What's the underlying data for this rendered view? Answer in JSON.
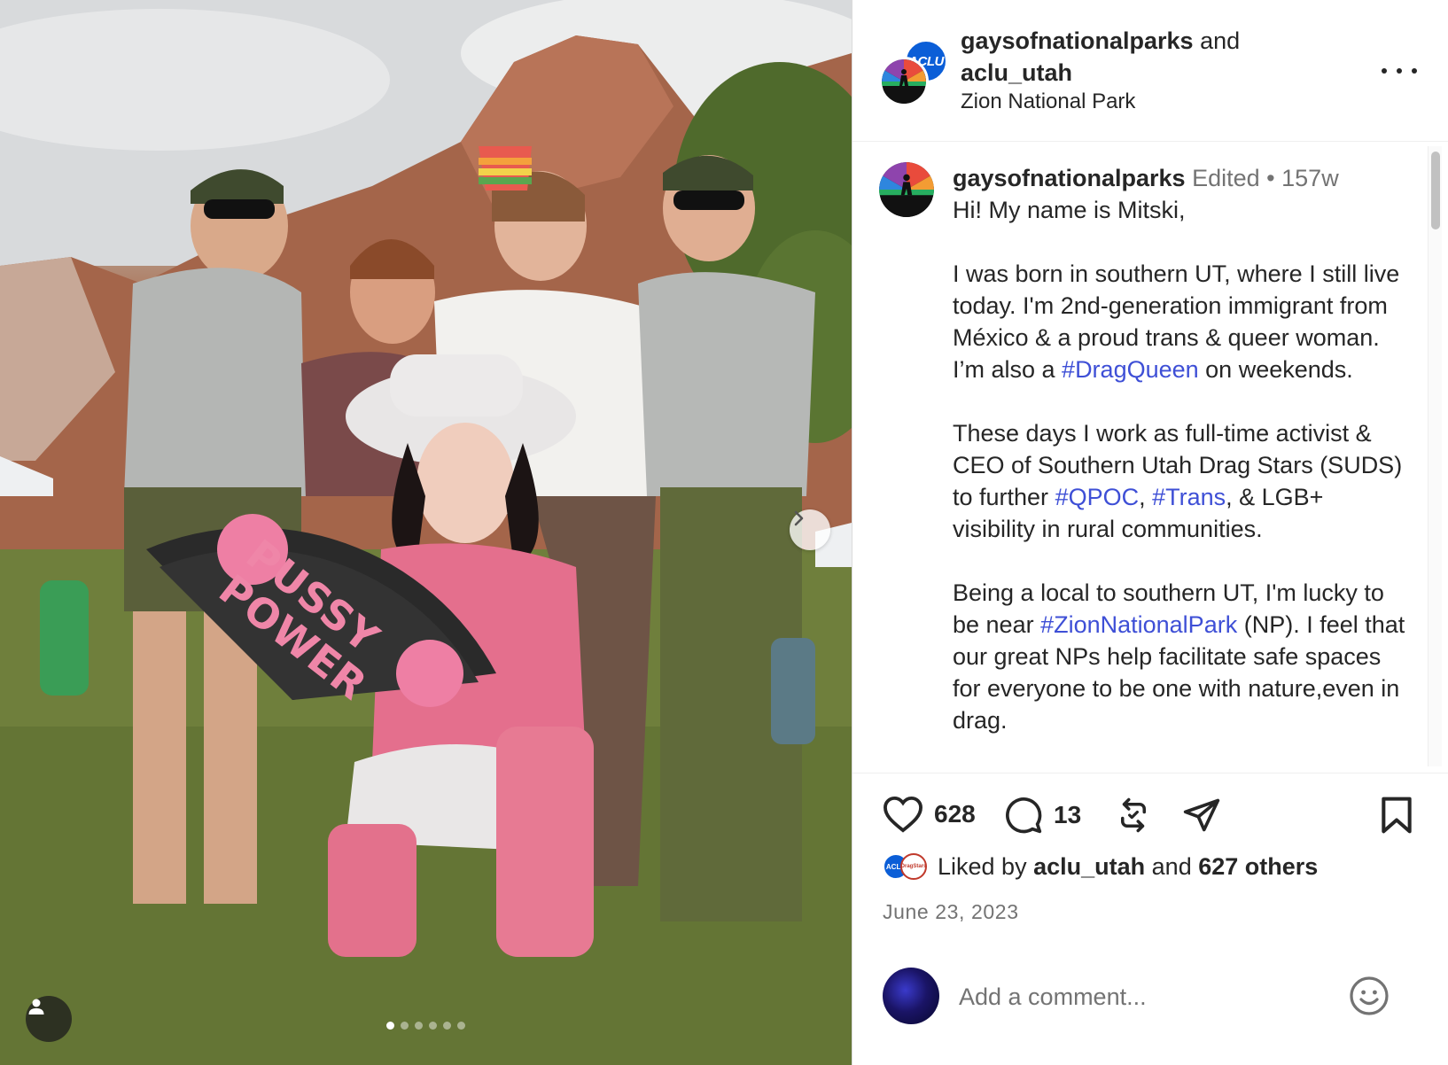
{
  "photo": {
    "fan_text_line1": "PUSSY",
    "fan_text_line2": "POWER",
    "carousel_total": 6,
    "carousel_active": 1
  },
  "header": {
    "user1": "gaysofnationalparks",
    "and_text": "and",
    "user2": "aclu_utah",
    "location": "Zion National Park",
    "aclu_avatar_text": "ACLU"
  },
  "caption": {
    "username": "gaysofnationalparks",
    "edited": "Edited",
    "separator": "•",
    "age": "157w",
    "p1": "Hi! My name is Mitski,",
    "p2a": "I was born in southern UT, where I still live today. I'm 2nd-generation immigrant from México & a proud trans & queer woman. I’m also a ",
    "p2_tag": "#DragQueen",
    "p2b": " on weekends.",
    "p3a": "These days I work as full-time activist & CEO of Southern Utah Drag Stars (SUDS) to further ",
    "p3_tag1": "#QPOC",
    "p3_sep": ", ",
    "p3_tag2": "#Trans",
    "p3b": ", & LGB+ visibility in rural communities.",
    "p4a": "Being a local to southern UT, I'm lucky to be near ",
    "p4_tag": "#ZionNationalPark",
    "p4b": " (NP). I feel that our great NPs help facilitate safe spaces for everyone to be one with nature,even in drag."
  },
  "actions": {
    "likes_count": "628",
    "comments_count": "13"
  },
  "likes": {
    "prefix": "Liked by",
    "user": "aclu_utah",
    "and": "and",
    "others": "627 others",
    "mini_av1_text": "ACLU",
    "mini_av2_text": "DragStars"
  },
  "date": "June 23, 2023",
  "comment": {
    "placeholder": "Add a comment..."
  },
  "colors": {
    "hashtag": "#3e4fd6",
    "muted": "#737373",
    "text": "#262626",
    "aclu_blue": "#0b5ed7"
  }
}
